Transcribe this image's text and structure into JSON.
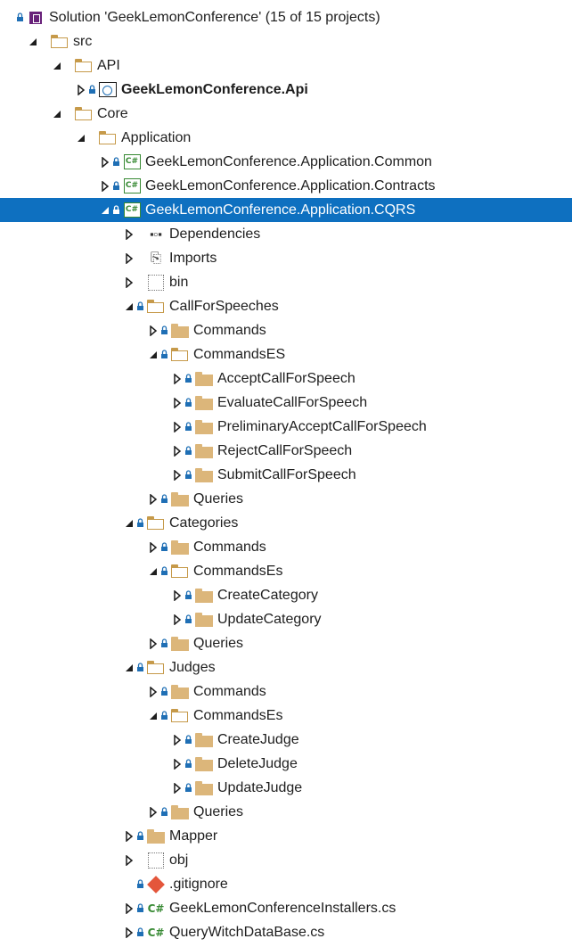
{
  "tree": {
    "rows": [
      {
        "label": "Solution 'GeekLemonConference' (15 of 15 projects)",
        "icon": "solution-icon",
        "expander": "none",
        "lock": true,
        "level": 0
      },
      {
        "label": "src",
        "icon": "folder-open-icon",
        "expander": "expanded",
        "lock": false,
        "level": 1
      },
      {
        "label": "API",
        "icon": "folder-open-icon",
        "expander": "expanded",
        "lock": false,
        "level": 2
      },
      {
        "label": "GeekLemonConference.Api",
        "icon": "web-project-icon",
        "expander": "collapsed",
        "lock": true,
        "level": 3,
        "bold": true
      },
      {
        "label": "Core",
        "icon": "folder-open-icon",
        "expander": "expanded",
        "lock": false,
        "level": 2
      },
      {
        "label": "Application",
        "icon": "folder-open-icon",
        "expander": "expanded",
        "lock": false,
        "level": 3
      },
      {
        "label": "GeekLemonConference.Application.Common",
        "icon": "csharp-project-icon",
        "expander": "collapsed",
        "lock": true,
        "level": 4
      },
      {
        "label": "GeekLemonConference.Application.Contracts",
        "icon": "csharp-project-icon",
        "expander": "collapsed",
        "lock": true,
        "level": 4
      },
      {
        "label": "GeekLemonConference.Application.CQRS",
        "icon": "csharp-project-icon",
        "expander": "expanded",
        "lock": true,
        "level": 4,
        "selected": true
      },
      {
        "label": "Dependencies",
        "icon": "dependencies-icon",
        "expander": "collapsed",
        "lock": false,
        "level": 5
      },
      {
        "label": "Imports",
        "icon": "imports-icon",
        "expander": "collapsed",
        "lock": false,
        "level": 5
      },
      {
        "label": "bin",
        "icon": "excluded-folder-icon",
        "expander": "collapsed",
        "lock": false,
        "level": 5
      },
      {
        "label": "CallForSpeeches",
        "icon": "folder-open-icon",
        "expander": "expanded",
        "lock": true,
        "level": 5
      },
      {
        "label": "Commands",
        "icon": "folder-icon",
        "expander": "collapsed",
        "lock": true,
        "level": 6
      },
      {
        "label": "CommandsES",
        "icon": "folder-open-icon",
        "expander": "expanded",
        "lock": true,
        "level": 6
      },
      {
        "label": "AcceptCallForSpeech",
        "icon": "folder-icon",
        "expander": "collapsed",
        "lock": true,
        "level": 7
      },
      {
        "label": "EvaluateCallForSpeech",
        "icon": "folder-icon",
        "expander": "collapsed",
        "lock": true,
        "level": 7
      },
      {
        "label": "PreliminaryAcceptCallForSpeech",
        "icon": "folder-icon",
        "expander": "collapsed",
        "lock": true,
        "level": 7
      },
      {
        "label": "RejectCallForSpeech",
        "icon": "folder-icon",
        "expander": "collapsed",
        "lock": true,
        "level": 7
      },
      {
        "label": "SubmitCallForSpeech",
        "icon": "folder-icon",
        "expander": "collapsed",
        "lock": true,
        "level": 7
      },
      {
        "label": "Queries",
        "icon": "folder-icon",
        "expander": "collapsed",
        "lock": true,
        "level": 6
      },
      {
        "label": "Categories",
        "icon": "folder-open-icon",
        "expander": "expanded",
        "lock": true,
        "level": 5
      },
      {
        "label": "Commands",
        "icon": "folder-icon",
        "expander": "collapsed",
        "lock": true,
        "level": 6
      },
      {
        "label": "CommandsEs",
        "icon": "folder-open-icon",
        "expander": "expanded",
        "lock": true,
        "level": 6
      },
      {
        "label": "CreateCategory",
        "icon": "folder-icon",
        "expander": "collapsed",
        "lock": true,
        "level": 7
      },
      {
        "label": "UpdateCategory",
        "icon": "folder-icon",
        "expander": "collapsed",
        "lock": true,
        "level": 7
      },
      {
        "label": "Queries",
        "icon": "folder-icon",
        "expander": "collapsed",
        "lock": true,
        "level": 6
      },
      {
        "label": "Judges",
        "icon": "folder-open-icon",
        "expander": "expanded",
        "lock": true,
        "level": 5
      },
      {
        "label": "Commands",
        "icon": "folder-icon",
        "expander": "collapsed",
        "lock": true,
        "level": 6
      },
      {
        "label": "CommandsEs",
        "icon": "folder-open-icon",
        "expander": "expanded",
        "lock": true,
        "level": 6
      },
      {
        "label": "CreateJudge",
        "icon": "folder-icon",
        "expander": "collapsed",
        "lock": true,
        "level": 7
      },
      {
        "label": "DeleteJudge",
        "icon": "folder-icon",
        "expander": "collapsed",
        "lock": true,
        "level": 7
      },
      {
        "label": "UpdateJudge",
        "icon": "folder-icon",
        "expander": "collapsed",
        "lock": true,
        "level": 7
      },
      {
        "label": "Queries",
        "icon": "folder-icon",
        "expander": "collapsed",
        "lock": true,
        "level": 6
      },
      {
        "label": "Mapper",
        "icon": "folder-icon",
        "expander": "collapsed",
        "lock": true,
        "level": 5
      },
      {
        "label": "obj",
        "icon": "excluded-folder-icon",
        "expander": "collapsed",
        "lock": false,
        "level": 5
      },
      {
        "label": ".gitignore",
        "icon": "git-icon",
        "expander": "none",
        "lock": true,
        "level": 5
      },
      {
        "label": "GeekLemonConferenceInstallers.cs",
        "icon": "csharp-file-icon",
        "expander": "collapsed",
        "lock": true,
        "level": 5
      },
      {
        "label": "QueryWitchDataBase.cs",
        "icon": "csharp-file-icon",
        "expander": "collapsed",
        "lock": true,
        "level": 5
      }
    ]
  }
}
